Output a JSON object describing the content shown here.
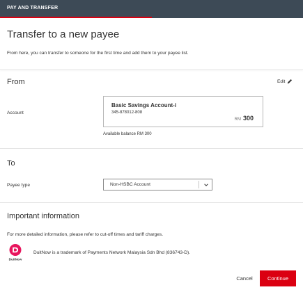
{
  "header": {
    "title": "PAY AND TRANSFER"
  },
  "page": {
    "title": "Transfer to a new payee",
    "intro": "From here, you can transfer to someone for the first time and add them to your payee list."
  },
  "from": {
    "heading": "From",
    "edit_label": "Edit",
    "account_label": "Account",
    "account": {
      "name": "Basic Savings Account-i",
      "number": "345-878012-808",
      "currency": "RM",
      "balance": "300"
    },
    "available_balance": "Available balance RM 300"
  },
  "to": {
    "heading": "To",
    "payee_type_label": "Payee type",
    "payee_type_value": "Non-HSBC Account"
  },
  "important": {
    "heading": "Important information",
    "text": "For more detailed information, please refer to cut-off times and tariff charges.",
    "duitnow_logo_label": "DuitNow",
    "duitnow_text": "DuitNow is a trademark of Payments Network Malaysia Sdn Bhd (836743-D)."
  },
  "actions": {
    "cancel": "Cancel",
    "continue": "Continue"
  },
  "colors": {
    "accent": "#db0011",
    "header_bg": "#3d4a56",
    "duitnow": "#e8155d"
  }
}
